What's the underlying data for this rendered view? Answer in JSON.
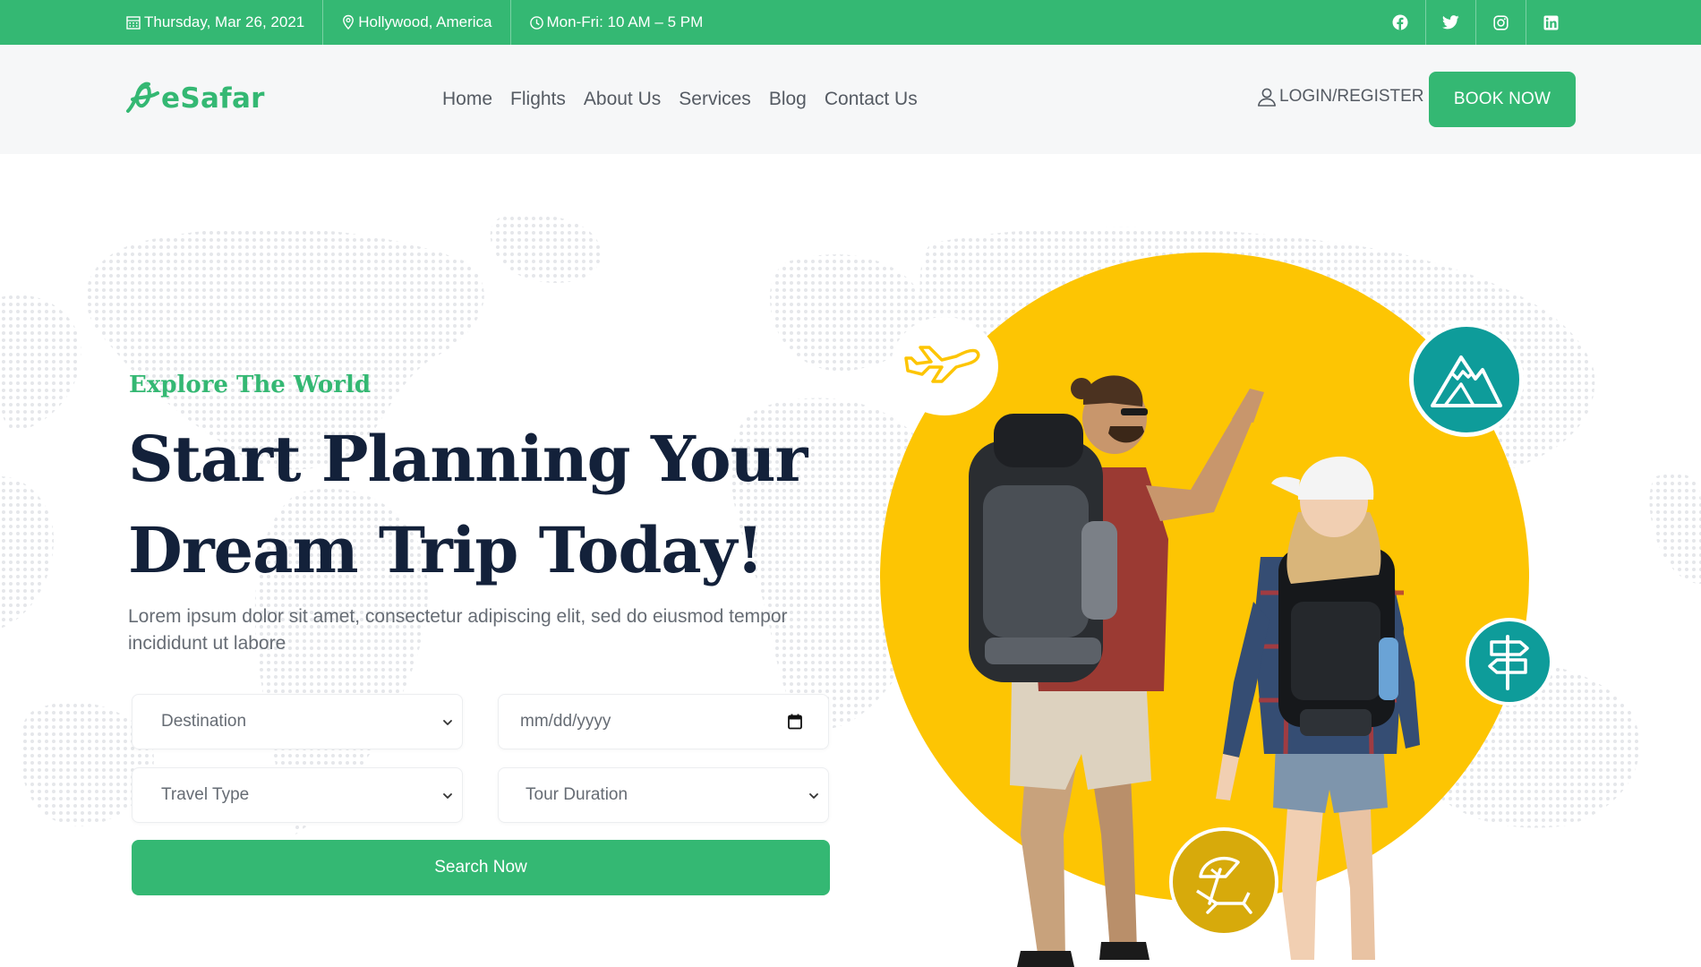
{
  "topbar": {
    "date": "Thursday, Mar 26, 2021",
    "location": "Hollywood, America",
    "hours": "Mon-Fri: 10 AM – 5 PM",
    "socials": [
      {
        "icon": "facebook-icon"
      },
      {
        "icon": "twitter-icon"
      },
      {
        "icon": "instagram-icon"
      },
      {
        "icon": "linkedin-icon"
      }
    ]
  },
  "header": {
    "logo_text": "eSafar",
    "nav": [
      "Home",
      "Flights",
      "About Us",
      "Services",
      "Blog",
      "Contact Us"
    ],
    "login_label": "LOGIN/REGISTER",
    "book_label": "BOOK NOW"
  },
  "hero": {
    "kicker": "Explore The World",
    "headline_line1": "Start Planning Your",
    "headline_line2": "Dream Trip Today!",
    "subtext": "Lorem ipsum dolor sit amet, consectetur adipiscing elit, sed do eiusmod tempor incididunt ut labore",
    "form": {
      "destination": "Destination",
      "date_placeholder": "mm/dd/yyyy",
      "travel_type": "Travel Type",
      "tour_duration": "Tour Duration",
      "search_label": "Search Now"
    }
  },
  "colors": {
    "brand_green": "#34b873",
    "accent_yellow": "#fdc503",
    "teal": "#0e9c9a",
    "gold": "#d7aa0b",
    "heading_navy": "#13213a"
  }
}
